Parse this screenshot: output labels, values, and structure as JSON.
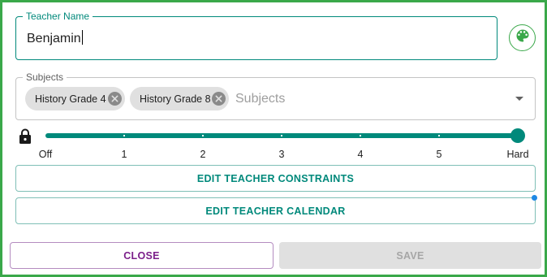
{
  "teacher_name": {
    "label": "Teacher Name",
    "value": "Benjamin"
  },
  "palette_button": {
    "icon": "palette-icon",
    "color": "#3aa84a"
  },
  "subjects": {
    "label": "Subjects",
    "placeholder": "Subjects",
    "chips": [
      {
        "label": "History Grade 4"
      },
      {
        "label": "History Grade 8"
      }
    ]
  },
  "constraint_slider": {
    "lock_icon": "lock-icon",
    "labels": [
      "Off",
      "1",
      "2",
      "3",
      "4",
      "5",
      "Hard"
    ],
    "selected": "Hard",
    "accent_color": "#00897b"
  },
  "actions": {
    "edit_constraints_label": "EDIT TEACHER CONSTRAINTS",
    "edit_calendar_label": "EDIT TEACHER CALENDAR",
    "close_label": "CLOSE",
    "save_label": "SAVE"
  },
  "colors": {
    "dialog_border": "#3aa84a",
    "primary": "#00897b",
    "close_text": "#7b1f8a",
    "save_disabled_bg": "#e0e0e0"
  }
}
